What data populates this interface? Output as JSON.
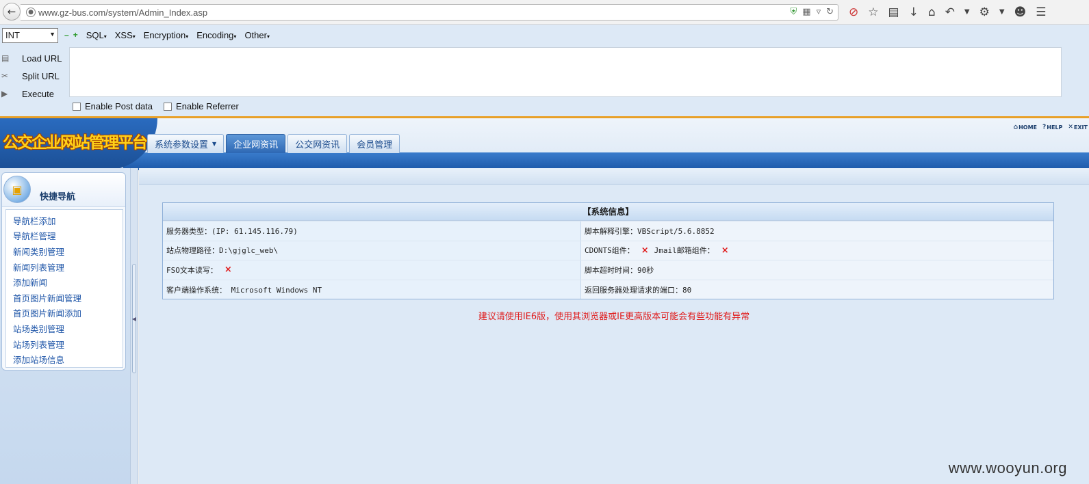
{
  "browser": {
    "url": "www.gz-bus.com/system/Admin_Index.asp",
    "back_icon": "back-arrow-icon"
  },
  "hackbar": {
    "select_value": "INT",
    "menus": [
      "SQL",
      "XSS",
      "Encryption",
      "Encoding",
      "Other"
    ],
    "actions": [
      "Load URL",
      "Split URL",
      "Execute"
    ],
    "textarea_value": "",
    "checks": [
      "Enable Post data",
      "Enable Referrer"
    ]
  },
  "header": {
    "logo": "公交企业网站管理平台",
    "tabs": [
      "系统参数设置",
      "企业网资讯",
      "公交网资讯",
      "会员管理"
    ],
    "active_tab_index": 1,
    "quick_links": [
      "HOME",
      "HELP",
      "EXIT"
    ]
  },
  "sidebar": {
    "title": "快捷导航",
    "items": [
      "导航栏添加",
      "导航栏管理",
      "新闻类别管理",
      "新闻列表管理",
      "添加新闻",
      "首页图片新闻管理",
      "首页图片新闻添加",
      "站场类别管理",
      "站场列表管理",
      "添加站场信息"
    ]
  },
  "system_info": {
    "title": "【系统信息】",
    "rows": [
      {
        "left": "服务器类型：(IP: 61.145.116.79)",
        "right": "脚本解释引擎：VBScript/5.6.8852"
      },
      {
        "left": "站点物理路径：D:\\gjglc_web\\",
        "right_a": "CDONTS组件：",
        "right_b": "Jmail邮箱组件："
      },
      {
        "left": "FSO文本读写：",
        "right": "脚本超时时间：90秒"
      },
      {
        "left": "客户端操作系统： Microsoft Windows NT",
        "right": "返回服务器处理请求的端口：80"
      }
    ],
    "cross_mark": "×"
  },
  "warning": "建议请使用IE6版，使用其浏览器或IE更高版本可能会有些功能有异常",
  "watermark": "www.wooyun.org",
  "colors": {
    "accent": "#2e68b4",
    "error": "#e01b1b",
    "logo_text": "#ffd21a"
  }
}
